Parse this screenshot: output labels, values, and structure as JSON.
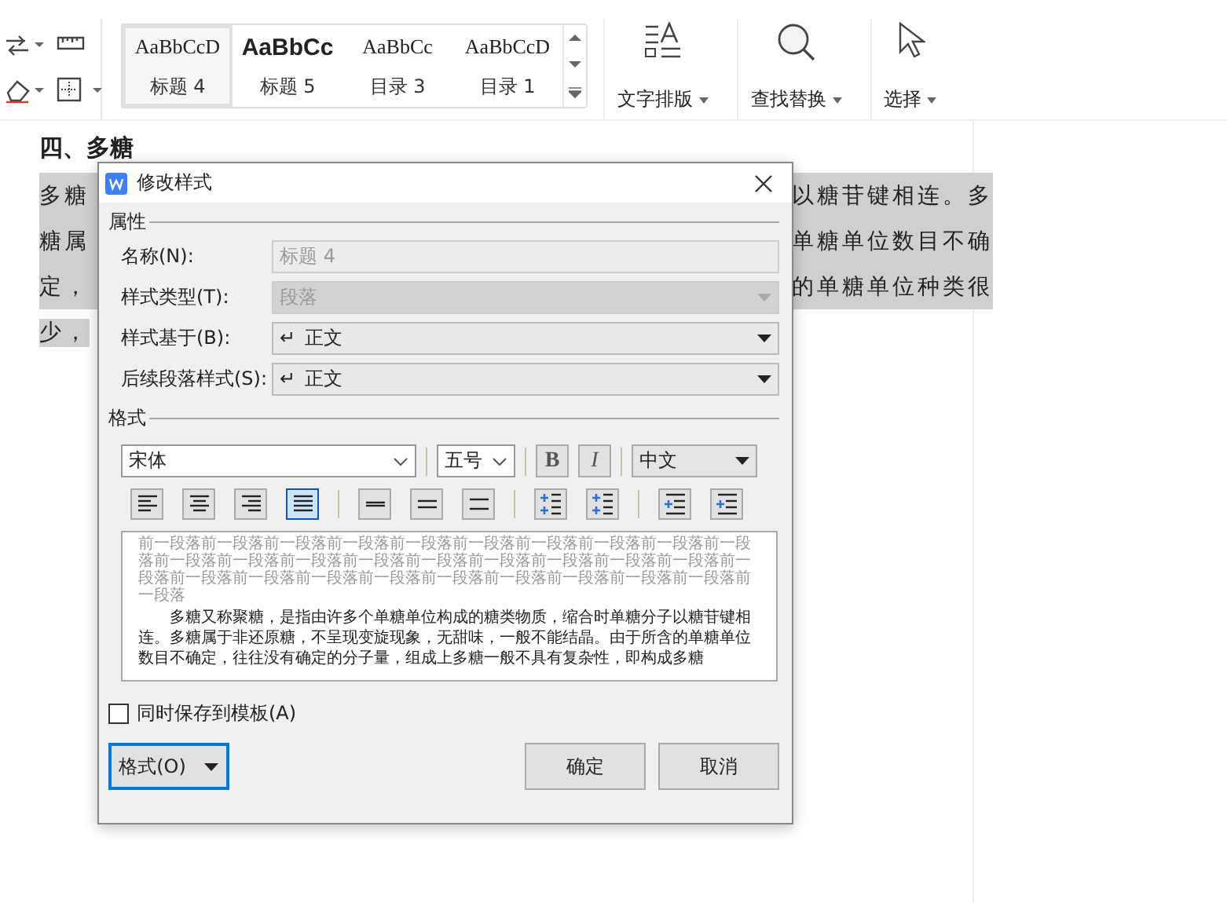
{
  "style_gallery": [
    {
      "sample": "AaBbCcD",
      "label": "标题 4",
      "selected": true,
      "kind": "serif"
    },
    {
      "sample": "AaBbCc",
      "label": "标题 5",
      "selected": false,
      "kind": "bold"
    },
    {
      "sample": "AaBbCc",
      "label": "目录 3",
      "selected": false,
      "kind": "serif"
    },
    {
      "sample": "AaBbCcD",
      "label": "目录 1",
      "selected": false,
      "kind": "serif"
    }
  ],
  "tool_buttons": [
    {
      "label": "文字排版",
      "kind": "layout"
    },
    {
      "label": "查找替换",
      "kind": "find"
    },
    {
      "label": "选择",
      "kind": "select"
    }
  ],
  "document": {
    "heading": "四、多糖",
    "lines": [
      {
        "left": "多糖",
        "right": "以糖苷键相连。多"
      },
      {
        "left": "糖属",
        "right": "单糖单位数目不确"
      },
      {
        "left": "定，",
        "right": "的单糖单位种类很"
      },
      {
        "left": "少，"
      }
    ]
  },
  "dialog": {
    "title": "修改样式",
    "properties_heading": "属性",
    "fields": [
      {
        "label": "名称(N):",
        "value": "标题 4",
        "kind": "text",
        "disabled": true
      },
      {
        "label": "样式类型(T):",
        "value": "段落",
        "kind": "select",
        "disabled": true
      },
      {
        "label": "样式基于(B):",
        "mark": "↵",
        "value": "正文",
        "kind": "select",
        "disabled": false
      },
      {
        "label": "后续段落样式(S):",
        "mark": "↵",
        "value": "正文",
        "kind": "select",
        "disabled": false
      }
    ],
    "format_heading": "格式",
    "font": "宋体",
    "size": "五号",
    "bold": {
      "label": "B",
      "on": false
    },
    "italic": {
      "label": "I",
      "on": false
    },
    "language": "中文",
    "paragraph_buttons": [
      {
        "kind": "align-left",
        "selected": false
      },
      {
        "kind": "align-center",
        "selected": false
      },
      {
        "kind": "align-right",
        "selected": false
      },
      {
        "kind": "justify",
        "selected": true
      },
      {
        "kind": "single-spacing",
        "selected": false
      },
      {
        "kind": "one-half-spacing",
        "selected": false
      },
      {
        "kind": "double-spacing",
        "selected": false
      },
      {
        "kind": "space-before",
        "selected": false
      },
      {
        "kind": "space-after",
        "selected": false
      },
      {
        "kind": "indent-decrease",
        "selected": false
      },
      {
        "kind": "indent-increase",
        "selected": false
      }
    ],
    "preview": {
      "previous": "前一段落前一段落前一段落前一段落前一段落前一段落前一段落前一段落前一段落前一段落前一段落前一段落前一段落前一段落前一段落前一段落前一段落前一段落前一段落前一段落前一段落前一段落前一段落前一段落前一段落前一段落前一段落前一段落前一段落前一段落",
      "body": "多糖又称聚糖，是指由许多个单糖单位构成的糖类物质，缩合时单糖分子以糖苷键相连。多糖属于非还原糖，不呈现变旋现象，无甜味，一般不能结晶。由于所含的单糖单位数目不确定，往往没有确定的分子量，组成上多糖一般不具有复杂性，即构成多糖"
    },
    "save_to_template": {
      "label": "同时保存到模板(A)",
      "checked": false
    },
    "format_button": "格式(O)",
    "ok_button": "确定",
    "cancel_button": "取消"
  }
}
